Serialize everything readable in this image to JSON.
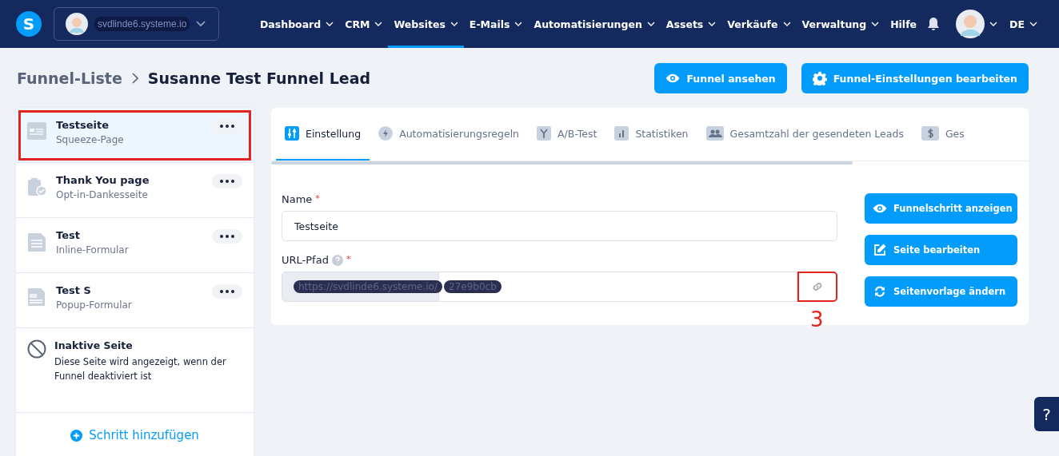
{
  "topbar": {
    "logo": "S",
    "account": "svdlinde6.systeme.io",
    "nav": [
      {
        "label": "Dashboard",
        "dropdown": true,
        "selected": false
      },
      {
        "label": "CRM",
        "dropdown": true,
        "selected": false
      },
      {
        "label": "Websites",
        "dropdown": true,
        "selected": true
      },
      {
        "label": "E-Mails",
        "dropdown": true,
        "selected": false
      },
      {
        "label": "Automatisierungen",
        "dropdown": true,
        "selected": false
      },
      {
        "label": "Assets",
        "dropdown": true,
        "selected": false
      },
      {
        "label": "Verkäufe",
        "dropdown": true,
        "selected": false
      },
      {
        "label": "Verwaltung",
        "dropdown": true,
        "selected": false
      },
      {
        "label": "Hilfe",
        "dropdown": false,
        "selected": false
      }
    ],
    "language": "DE"
  },
  "breadcrumb": {
    "parent": "Funnel-Liste",
    "current": "Susanne Test Funnel Lead"
  },
  "header_buttons": [
    {
      "label": "Funnel ansehen",
      "kind": "view"
    },
    {
      "label": "Funnel-Einstellungen bearbeiten",
      "kind": "settings"
    }
  ],
  "steps": [
    {
      "title": "Testseite",
      "subtitle": "Squeeze-Page",
      "kind": "squeeze",
      "selected": true,
      "highlighted": true
    },
    {
      "title": "Thank You page",
      "subtitle": "Opt-in-Dankesseite",
      "kind": "thankyou",
      "selected": false,
      "highlighted": false
    },
    {
      "title": "Test",
      "subtitle": "Inline-Formular",
      "kind": "inline",
      "selected": false,
      "highlighted": false
    },
    {
      "title": "Test S",
      "subtitle": "Popup-Formular",
      "kind": "popup",
      "selected": false,
      "highlighted": false
    }
  ],
  "inactive_page": {
    "title": "Inaktive Seite",
    "description": "Diese Seite wird angezeigt, wenn der Funnel deaktiviert ist"
  },
  "add_step": "Schritt hinzufügen",
  "tabs": [
    {
      "label": "Einstellung",
      "kind": "settings",
      "selected": true
    },
    {
      "label": "Automatisierungsregeln",
      "kind": "automation",
      "selected": false
    },
    {
      "label": "A/B-Test",
      "kind": "abtest",
      "selected": false
    },
    {
      "label": "Statistiken",
      "kind": "stats",
      "selected": false
    },
    {
      "label": "Gesamtzahl der gesendeten Leads",
      "kind": "leads",
      "selected": false
    },
    {
      "label": "Ges",
      "kind": "sales",
      "selected": false
    }
  ],
  "form": {
    "name_label": "Name",
    "name_required": "*",
    "name_value": "Testseite",
    "url_label": "URL-Pfad",
    "url_required": "*",
    "url_prefix": "https://svdlinde6.systeme.io/",
    "url_value": "27e9b0cb",
    "link_highlighted": true,
    "annotation": "3"
  },
  "side_buttons": [
    {
      "label": "Funnelschritt anzeigen",
      "kind": "view"
    },
    {
      "label": "Seite bearbeiten",
      "kind": "edit"
    },
    {
      "label": "Seitenvorlage ändern",
      "kind": "template"
    }
  ],
  "help_button": "?"
}
